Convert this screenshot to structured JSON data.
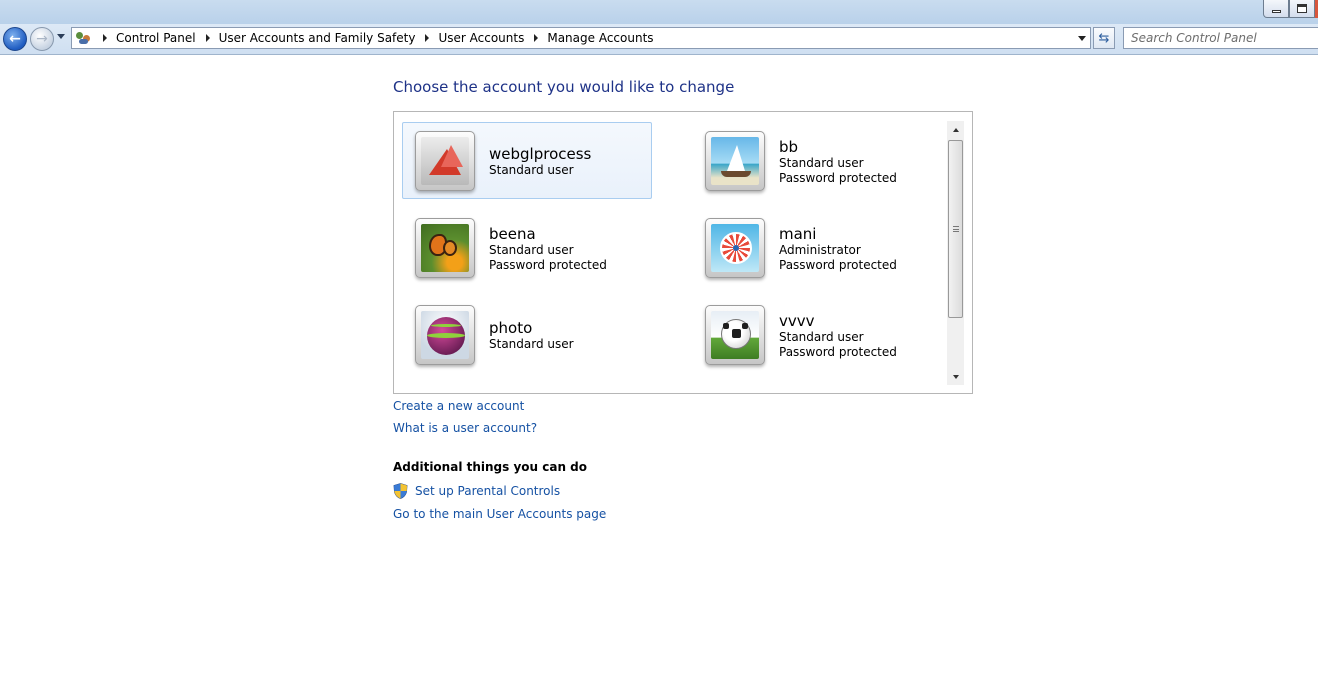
{
  "address_bar": {
    "breadcrumbs": [
      "Control Panel",
      "User Accounts and Family Safety",
      "User Accounts",
      "Manage Accounts"
    ]
  },
  "search": {
    "placeholder": "Search Control Panel"
  },
  "main": {
    "heading": "Choose the account you would like to change",
    "accounts": [
      {
        "name": "webglprocess",
        "lines": [
          "Standard user"
        ],
        "picture": "origami-crane",
        "selected": true
      },
      {
        "name": "bb",
        "lines": [
          "Standard user",
          "Password protected"
        ],
        "picture": "sailboat"
      },
      {
        "name": "beena",
        "lines": [
          "Standard user",
          "Password protected"
        ],
        "picture": "butterfly"
      },
      {
        "name": "mani",
        "lines": [
          "Administrator",
          "Password protected"
        ],
        "picture": "pinwheel"
      },
      {
        "name": "photo",
        "lines": [
          "Standard user"
        ],
        "picture": "ball"
      },
      {
        "name": "vvvv",
        "lines": [
          "Standard user",
          "Password protected"
        ],
        "picture": "soccer-ball"
      }
    ],
    "links": {
      "create_account": "Create a new account",
      "what_is_account": "What is a user account?"
    },
    "additional": {
      "title": "Additional things you can do",
      "parental_controls": "Set up Parental Controls",
      "main_page": "Go to the main User Accounts page"
    }
  },
  "colors": {
    "heading": "#1e3287",
    "link": "#1551a3",
    "selection_border": "#a9cdf0"
  }
}
